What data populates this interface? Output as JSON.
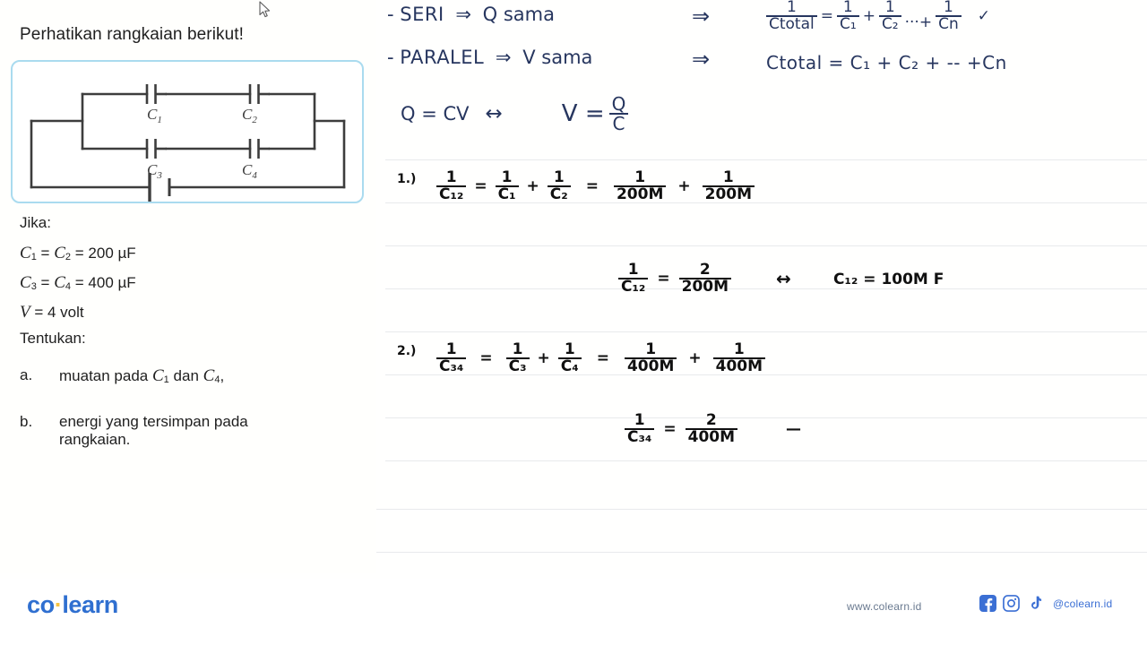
{
  "question": {
    "title": "Perhatikan rangkaian berikut!",
    "circuit": {
      "labels": [
        "C1",
        "C2",
        "C3",
        "C4"
      ],
      "label_text": [
        "C",
        "C",
        "C",
        "C"
      ],
      "label_subs": [
        "1",
        "2",
        "3",
        "4"
      ]
    },
    "given_heading": "Jika:",
    "given": [
      {
        "lhs1": "C",
        "sub1": "1",
        "eq1": "=",
        "lhs2": "C",
        "sub2": "2",
        "eq2": "= 200 µF"
      },
      {
        "lhs1": "C",
        "sub1": "3",
        "eq1": "=",
        "lhs2": "C",
        "sub2": "4",
        "eq2": "= 400 µF"
      }
    ],
    "voltage": {
      "symbol": "V",
      "value": "= 4 volt"
    },
    "ask_heading": "Tentukan:",
    "items": [
      {
        "marker": "a.",
        "text_before": "muatan pada",
        "sym1": "C",
        "sub1": "1",
        "mid": "dan",
        "sym2": "C",
        "sub2": "4",
        "text_after": ","
      },
      {
        "marker": "b.",
        "line1": "energi yang tersimpan pada",
        "line2": "rangkaian."
      }
    ]
  },
  "notes": {
    "rules": [
      {
        "dash": "-",
        "label": "SERI",
        "arrow": "⇒",
        "result": "Q sama"
      },
      {
        "dash": "-",
        "label": "PARALEL",
        "arrow": "⇒",
        "result": "V sama"
      }
    ],
    "implies": "⇒",
    "series_formula": {
      "lhs_num": "1",
      "lhs_den": "Ctotal",
      "t1_num": "1",
      "t1_den": "C₁",
      "plus1": "+",
      "t2_num": "1",
      "t2_den": "C₂",
      "dots": "···+",
      "t3_num": "1",
      "t3_den": "Cn",
      "check": "✓"
    },
    "parallel_formula": {
      "text": "Ctotal  =  C₁ + C₂ +  --  +Cn"
    },
    "qcv": {
      "left": "Q = CV",
      "arrow": "↔",
      "right_v": "V =",
      "num": "Q",
      "den": "C"
    }
  },
  "work": {
    "step1": {
      "number": "1.)",
      "lhs_num": "1",
      "lhs_den": "C₁₂",
      "eq1": "=",
      "a_num": "1",
      "a_den": "C₁",
      "plus1": "+",
      "b_num": "1",
      "b_den": "C₂",
      "eq2": "=",
      "c_num": "1",
      "c_den": "200M",
      "plus2": "+",
      "d_num": "1",
      "d_den": "200M",
      "line2_num": "1",
      "line2_den": "C₁₂",
      "line2_eq": "=",
      "line2_rnum": "2",
      "line2_rden": "200M",
      "iff": "↔",
      "result": "C₁₂ = 100M F"
    },
    "step2": {
      "number": "2.)",
      "lhs_num": "1",
      "lhs_den": "C₃₄",
      "eq1": "=",
      "a_num": "1",
      "a_den": "C₃",
      "plus1": "+",
      "b_num": "1",
      "b_den": "C₄",
      "eq2": "=",
      "c_num": "1",
      "c_den": "400M",
      "plus2": "+",
      "d_num": "1",
      "d_den": "400M",
      "line2_num": "1",
      "line2_den": "C₃₄",
      "line2_eq": "=",
      "line2_rnum": "2",
      "line2_rden": "400M",
      "dash": "—"
    }
  },
  "footer": {
    "brand_a": "co",
    "brand_dot": "·",
    "brand_b": "learn",
    "url": "www.colearn.id",
    "handle": "@colearn.id",
    "social": [
      "facebook-icon",
      "instagram-icon",
      "tiktok-icon"
    ]
  },
  "colors": {
    "panel_border": "#aadbef",
    "brand_blue": "#2f6fd0",
    "brand_yellow": "#f6c343",
    "ink_blue": "#27365f",
    "ink_black": "#101010",
    "rule_line": "#e9eaec"
  }
}
